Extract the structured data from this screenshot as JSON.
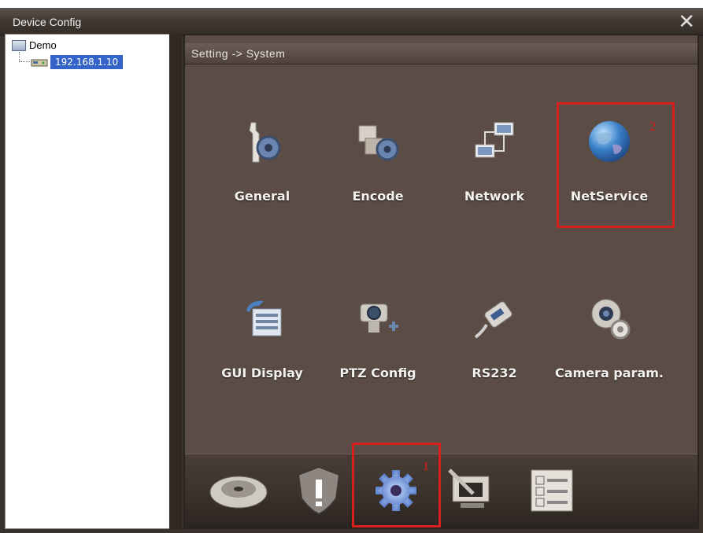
{
  "window": {
    "title": "Device Config",
    "close_glyph": "✕"
  },
  "tree": {
    "root_label": "Demo",
    "children": [
      {
        "label": "192.168.1.10",
        "selected": true
      }
    ]
  },
  "main": {
    "breadcrumb": "Setting -> System",
    "items": [
      {
        "label": "General",
        "icon": "wrench-gear-icon"
      },
      {
        "label": "Encode",
        "icon": "puzzle-gear-icon"
      },
      {
        "label": "Network",
        "icon": "network-computers-icon"
      },
      {
        "label": "NetService",
        "icon": "globe-icon"
      },
      {
        "label": "GUI Display",
        "icon": "display-list-icon"
      },
      {
        "label": "PTZ Config",
        "icon": "ptz-camera-icon"
      },
      {
        "label": "RS232",
        "icon": "serial-cable-icon"
      },
      {
        "label": "Camera param.",
        "icon": "webcam-gear-icon"
      }
    ],
    "callouts": {
      "first": "1",
      "second": "2"
    },
    "tabs": [
      {
        "icon": "hard-disk-icon"
      },
      {
        "icon": "shield-alert-icon"
      },
      {
        "icon": "gear-icon",
        "active": true
      },
      {
        "icon": "tools-computer-icon"
      },
      {
        "icon": "checklist-icon"
      }
    ]
  },
  "colors": {
    "highlight": "#d61f1f",
    "panel": "#5b4d45",
    "selection": "#3464c8"
  }
}
